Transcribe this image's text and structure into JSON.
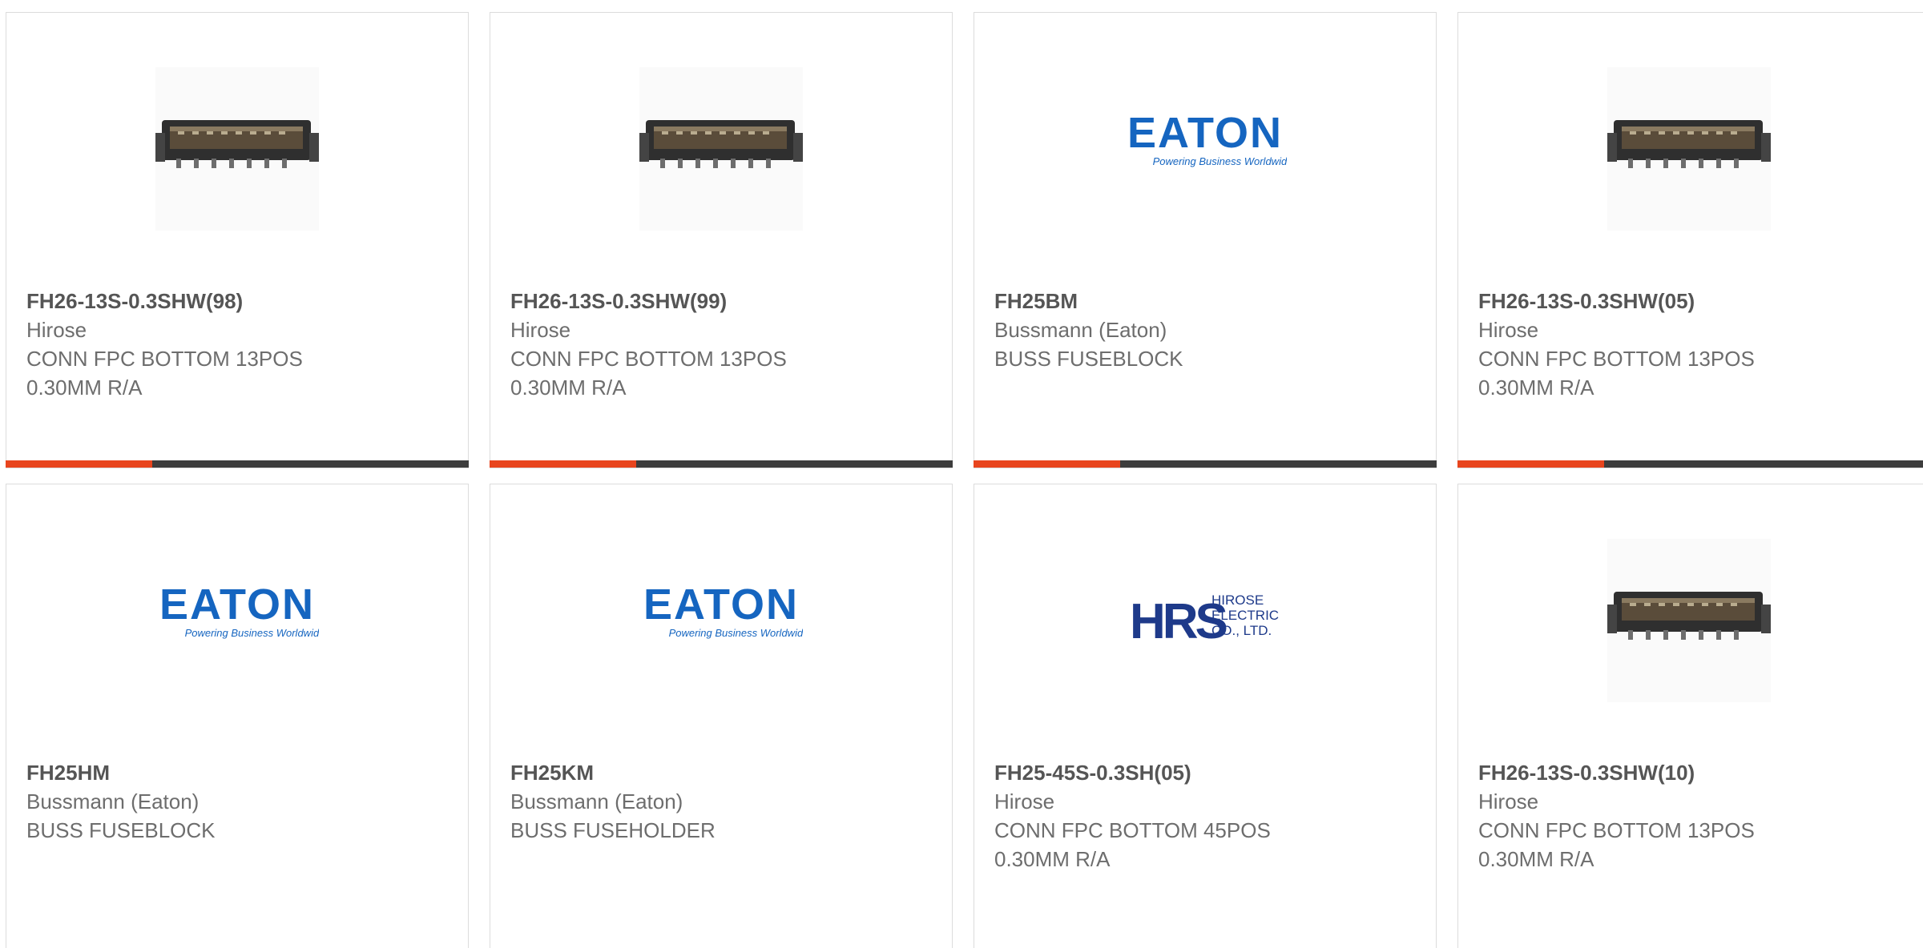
{
  "colors": {
    "accent": "#e8451e",
    "bar": "#3d3d3d",
    "text": "#6d6d6d",
    "eaton_blue": "#1565c0",
    "hrs_navy": "#1e3a8a"
  },
  "products": [
    {
      "part_number": "FH26-13S-0.3SHW(98)",
      "manufacturer": "Hirose",
      "description": "CONN FPC BOTTOM 13POS 0.30MM R/A",
      "image": "connector-image"
    },
    {
      "part_number": "FH26-13S-0.3SHW(99)",
      "manufacturer": "Hirose",
      "description": "CONN FPC BOTTOM 13POS 0.30MM R/A",
      "image": "connector-image"
    },
    {
      "part_number": "FH25BM",
      "manufacturer": "Bussmann (Eaton)",
      "description": "BUSS FUSEBLOCK",
      "image": "eaton-logo"
    },
    {
      "part_number": "FH26-13S-0.3SHW(05)",
      "manufacturer": "Hirose",
      "description": "CONN FPC BOTTOM 13POS 0.30MM R/A",
      "image": "connector-image"
    },
    {
      "part_number": "FH25HM",
      "manufacturer": "Bussmann (Eaton)",
      "description": "BUSS FUSEBLOCK",
      "image": "eaton-logo"
    },
    {
      "part_number": "FH25KM",
      "manufacturer": "Bussmann (Eaton)",
      "description": "BUSS FUSEHOLDER",
      "image": "eaton-logo"
    },
    {
      "part_number": "FH25-45S-0.3SH(05)",
      "manufacturer": "Hirose",
      "description": "CONN FPC BOTTOM 45POS 0.30MM R/A",
      "image": "hrs-logo"
    },
    {
      "part_number": "FH26-13S-0.3SHW(10)",
      "manufacturer": "Hirose",
      "description": "CONN FPC BOTTOM 13POS 0.30MM R/A",
      "image": "connector-image"
    }
  ],
  "logos": {
    "eaton_wordmark": "EATON",
    "eaton_tagline": "Powering Business Worldwide",
    "hrs_mark": "HRS",
    "hrs_line1": "HIROSE",
    "hrs_line2": "ELECTRIC",
    "hrs_line3": "CO., LTD."
  }
}
